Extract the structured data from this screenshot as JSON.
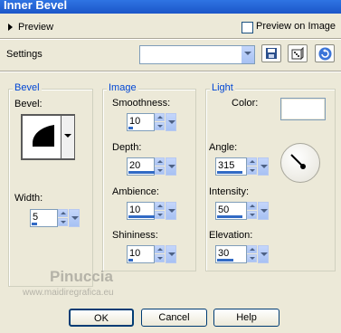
{
  "window": {
    "title": "Inner Bevel"
  },
  "preview": {
    "label": "Preview",
    "preview_on_image_label": "Preview on Image"
  },
  "settings": {
    "label": "Settings",
    "value": ""
  },
  "bevel_group": {
    "title": "Bevel",
    "bevel_label": "Bevel:",
    "width_label": "Width:",
    "width_value": "5"
  },
  "image_group": {
    "title": "Image",
    "smoothness_label": "Smoothness:",
    "smoothness_value": "10",
    "depth_label": "Depth:",
    "depth_value": "20",
    "ambience_label": "Ambience:",
    "ambience_value": "10",
    "shininess_label": "Shininess:",
    "shininess_value": "10"
  },
  "light_group": {
    "title": "Light",
    "color_label": "Color:",
    "color_value": "#ffffff",
    "angle_label": "Angle:",
    "angle_value": "315",
    "intensity_label": "Intensity:",
    "intensity_value": "50",
    "elevation_label": "Elevation:",
    "elevation_value": "30"
  },
  "watermark": {
    "name": "Pinuccia",
    "url": "www.maidiregrafica.eu"
  },
  "buttons": {
    "ok": "OK",
    "cancel": "Cancel",
    "help": "Help"
  },
  "colors": {
    "title_bar": "#1b56c8",
    "accent": "#316ac5",
    "group_label": "#0046d5"
  }
}
